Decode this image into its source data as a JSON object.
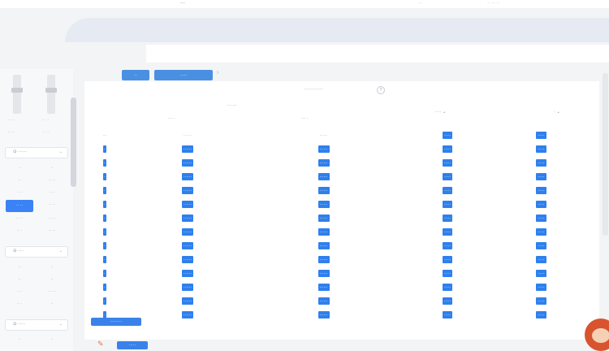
{
  "topbar": {
    "items": [
      "—",
      "···",
      "·· ·· ··"
    ]
  },
  "left_panel": {
    "fader_labels": [
      "·· ··",
      "·· ··"
    ],
    "fader_sub": [
      "·· ··",
      "·· ··"
    ],
    "dropdown1": {
      "label": "⊙ ······",
      "chev": "⌄"
    },
    "grid1": [
      {
        "t": "··"
      },
      {
        "t": "··"
      },
      {
        "t": "··"
      },
      {
        "t": "·· ··"
      },
      {
        "t": "·· ·"
      },
      {
        "t": "·· ·"
      },
      {
        "t": "·· ··",
        "sel": true
      },
      {
        "t": "·· ··"
      },
      {
        "t": "·· ··"
      },
      {
        "t": "·· ··"
      },
      {
        "t": "·· ·"
      },
      {
        "t": "·· ··"
      }
    ],
    "dropdown2": {
      "label": "⊙ ····",
      "chev": "⌄"
    },
    "grid2": [
      {
        "t": "··"
      },
      {
        "t": "··"
      },
      {
        "t": "··"
      },
      {
        "t": "··"
      },
      {
        "t": "·· ·"
      },
      {
        "t": "·· ···"
      },
      {
        "t": "·· ·"
      },
      {
        "t": "··"
      }
    ],
    "dropdown3": {
      "label": "⊙ ·····",
      "chev": "⌄"
    },
    "grid3": [
      {
        "t": "··"
      },
      {
        "t": "··"
      }
    ]
  },
  "tabs": [
    "··",
    "·····"
  ],
  "tab_arrow": "›",
  "content": {
    "title": "············",
    "title_btn": "?",
    "group_header": "·······",
    "col_headers": [
      "··· ·",
      "··· ·",
      "···· ⌄",
      "· ⌄"
    ],
    "rows": [
      [
        "···",
        "······",
        "······",
        "·····",
        "·····"
      ],
      [
        "·",
        "······",
        "······",
        "·····",
        "·····"
      ],
      [
        "·",
        "······",
        "······",
        "·····",
        "·····"
      ],
      [
        "·",
        "······",
        "······",
        "·····",
        "·····"
      ],
      [
        "·",
        "······",
        "······",
        "·····",
        "·····"
      ],
      [
        "·",
        "······",
        "······",
        "·····",
        "·····"
      ],
      [
        "·",
        "······",
        "······",
        "·····",
        "·····"
      ],
      [
        "·",
        "······",
        "······",
        "·····",
        "·····"
      ],
      [
        "·",
        "······",
        "······",
        "·····",
        "·····"
      ],
      [
        "·",
        "······",
        "······",
        "·····",
        "·····"
      ],
      [
        "·",
        "······",
        "······",
        "·····",
        "·····"
      ],
      [
        "·",
        "······",
        "······",
        "·····",
        "·····"
      ],
      [
        "·",
        "······",
        "······",
        "·····",
        "·····"
      ],
      [
        "·",
        "······",
        "······",
        "·····",
        "·····"
      ]
    ],
    "pill1": "·········",
    "pill2": "·····"
  },
  "footer_icon": "✎",
  "colors": {
    "accent": "#2f80ed",
    "tab": "#4a90e2"
  }
}
